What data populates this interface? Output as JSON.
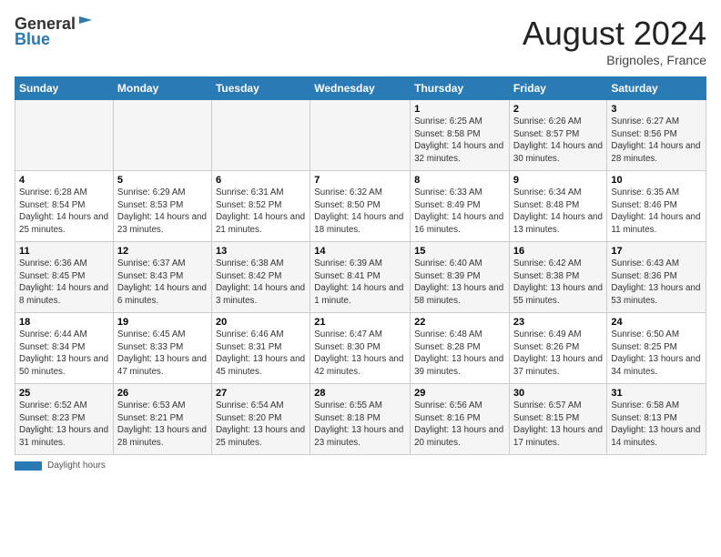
{
  "header": {
    "logo_line1": "General",
    "logo_line2": "Blue",
    "month_title": "August 2024",
    "location": "Brignoles, France"
  },
  "footer": {
    "label": "Daylight hours"
  },
  "days_of_week": [
    "Sunday",
    "Monday",
    "Tuesday",
    "Wednesday",
    "Thursday",
    "Friday",
    "Saturday"
  ],
  "weeks": [
    [
      {
        "num": "",
        "info": ""
      },
      {
        "num": "",
        "info": ""
      },
      {
        "num": "",
        "info": ""
      },
      {
        "num": "",
        "info": ""
      },
      {
        "num": "1",
        "info": "Sunrise: 6:25 AM\nSunset: 8:58 PM\nDaylight: 14 hours and 32 minutes."
      },
      {
        "num": "2",
        "info": "Sunrise: 6:26 AM\nSunset: 8:57 PM\nDaylight: 14 hours and 30 minutes."
      },
      {
        "num": "3",
        "info": "Sunrise: 6:27 AM\nSunset: 8:56 PM\nDaylight: 14 hours and 28 minutes."
      }
    ],
    [
      {
        "num": "4",
        "info": "Sunrise: 6:28 AM\nSunset: 8:54 PM\nDaylight: 14 hours and 25 minutes."
      },
      {
        "num": "5",
        "info": "Sunrise: 6:29 AM\nSunset: 8:53 PM\nDaylight: 14 hours and 23 minutes."
      },
      {
        "num": "6",
        "info": "Sunrise: 6:31 AM\nSunset: 8:52 PM\nDaylight: 14 hours and 21 minutes."
      },
      {
        "num": "7",
        "info": "Sunrise: 6:32 AM\nSunset: 8:50 PM\nDaylight: 14 hours and 18 minutes."
      },
      {
        "num": "8",
        "info": "Sunrise: 6:33 AM\nSunset: 8:49 PM\nDaylight: 14 hours and 16 minutes."
      },
      {
        "num": "9",
        "info": "Sunrise: 6:34 AM\nSunset: 8:48 PM\nDaylight: 14 hours and 13 minutes."
      },
      {
        "num": "10",
        "info": "Sunrise: 6:35 AM\nSunset: 8:46 PM\nDaylight: 14 hours and 11 minutes."
      }
    ],
    [
      {
        "num": "11",
        "info": "Sunrise: 6:36 AM\nSunset: 8:45 PM\nDaylight: 14 hours and 8 minutes."
      },
      {
        "num": "12",
        "info": "Sunrise: 6:37 AM\nSunset: 8:43 PM\nDaylight: 14 hours and 6 minutes."
      },
      {
        "num": "13",
        "info": "Sunrise: 6:38 AM\nSunset: 8:42 PM\nDaylight: 14 hours and 3 minutes."
      },
      {
        "num": "14",
        "info": "Sunrise: 6:39 AM\nSunset: 8:41 PM\nDaylight: 14 hours and 1 minute."
      },
      {
        "num": "15",
        "info": "Sunrise: 6:40 AM\nSunset: 8:39 PM\nDaylight: 13 hours and 58 minutes."
      },
      {
        "num": "16",
        "info": "Sunrise: 6:42 AM\nSunset: 8:38 PM\nDaylight: 13 hours and 55 minutes."
      },
      {
        "num": "17",
        "info": "Sunrise: 6:43 AM\nSunset: 8:36 PM\nDaylight: 13 hours and 53 minutes."
      }
    ],
    [
      {
        "num": "18",
        "info": "Sunrise: 6:44 AM\nSunset: 8:34 PM\nDaylight: 13 hours and 50 minutes."
      },
      {
        "num": "19",
        "info": "Sunrise: 6:45 AM\nSunset: 8:33 PM\nDaylight: 13 hours and 47 minutes."
      },
      {
        "num": "20",
        "info": "Sunrise: 6:46 AM\nSunset: 8:31 PM\nDaylight: 13 hours and 45 minutes."
      },
      {
        "num": "21",
        "info": "Sunrise: 6:47 AM\nSunset: 8:30 PM\nDaylight: 13 hours and 42 minutes."
      },
      {
        "num": "22",
        "info": "Sunrise: 6:48 AM\nSunset: 8:28 PM\nDaylight: 13 hours and 39 minutes."
      },
      {
        "num": "23",
        "info": "Sunrise: 6:49 AM\nSunset: 8:26 PM\nDaylight: 13 hours and 37 minutes."
      },
      {
        "num": "24",
        "info": "Sunrise: 6:50 AM\nSunset: 8:25 PM\nDaylight: 13 hours and 34 minutes."
      }
    ],
    [
      {
        "num": "25",
        "info": "Sunrise: 6:52 AM\nSunset: 8:23 PM\nDaylight: 13 hours and 31 minutes."
      },
      {
        "num": "26",
        "info": "Sunrise: 6:53 AM\nSunset: 8:21 PM\nDaylight: 13 hours and 28 minutes."
      },
      {
        "num": "27",
        "info": "Sunrise: 6:54 AM\nSunset: 8:20 PM\nDaylight: 13 hours and 25 minutes."
      },
      {
        "num": "28",
        "info": "Sunrise: 6:55 AM\nSunset: 8:18 PM\nDaylight: 13 hours and 23 minutes."
      },
      {
        "num": "29",
        "info": "Sunrise: 6:56 AM\nSunset: 8:16 PM\nDaylight: 13 hours and 20 minutes."
      },
      {
        "num": "30",
        "info": "Sunrise: 6:57 AM\nSunset: 8:15 PM\nDaylight: 13 hours and 17 minutes."
      },
      {
        "num": "31",
        "info": "Sunrise: 6:58 AM\nSunset: 8:13 PM\nDaylight: 13 hours and 14 minutes."
      }
    ]
  ]
}
